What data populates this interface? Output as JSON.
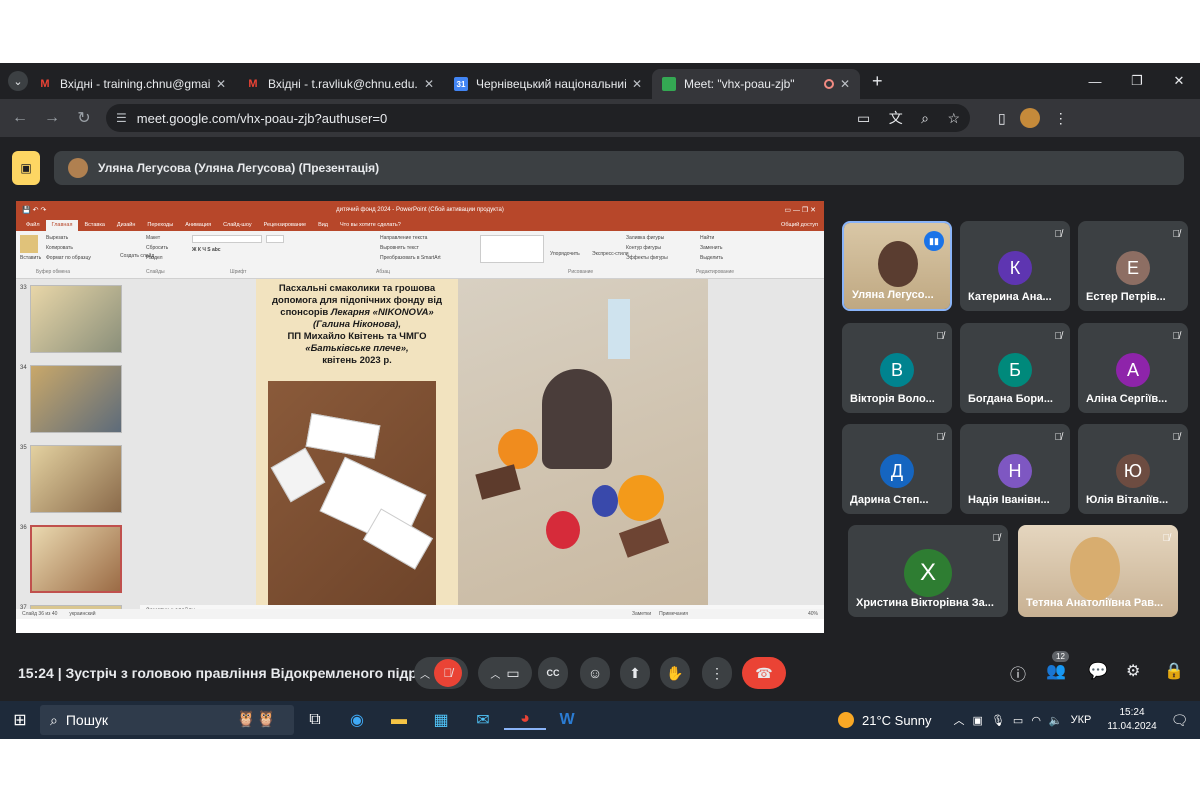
{
  "browser": {
    "tabs": [
      {
        "icon": "gmail-icon",
        "title": "Вхідні - training.chnu@gmail.co",
        "active": false
      },
      {
        "icon": "gmail-icon",
        "title": "Вхідні - t.ravliuk@chnu.edu.ua",
        "active": false
      },
      {
        "icon": "calendar-icon",
        "title": "Чернівецький національний у",
        "active": false
      },
      {
        "icon": "meet-icon",
        "title": "Meet: \"vhx-poau-zjb\"",
        "active": true
      }
    ],
    "url": "meet.google.com/vhx-poau-zjb?authuser=0"
  },
  "meet": {
    "presenter_banner": "Уляна Легусова (Уляна Легусова) (Презентація)",
    "time": "15:24",
    "meeting_title": "Зустріч з головою правління Відокремленого підр...",
    "participant_count": "12",
    "participants": [
      {
        "name": "Уляна Легусо...",
        "initial": "",
        "color": "#c9b49a",
        "video": true,
        "speaking": true
      },
      {
        "name": "Катерина Ана...",
        "initial": "К",
        "color": "#5e35b1"
      },
      {
        "name": "Естер Петрів...",
        "initial": "Е",
        "color": "#8d6e63"
      },
      {
        "name": "Вікторія Воло...",
        "initial": "В",
        "color": "#00838f"
      },
      {
        "name": "Богдана Бори...",
        "initial": "Б",
        "color": "#00897b"
      },
      {
        "name": "Аліна Сергіїв...",
        "initial": "А",
        "color": "#8e24aa"
      },
      {
        "name": "Дарина Степ...",
        "initial": "Д",
        "color": "#1565c0"
      },
      {
        "name": "Надія Іванівн...",
        "initial": "Н",
        "color": "#7e57c2"
      },
      {
        "name": "Юлія Віталіїв...",
        "initial": "Ю",
        "color": "#6d4c41"
      },
      {
        "name": "Христина Вікторівна За...",
        "initial": "Х",
        "color": "#2e7d32"
      },
      {
        "name": "Тетяна Анатоліївна Рав...",
        "initial": "",
        "color": "#b58d5e",
        "video": true
      }
    ]
  },
  "powerpoint": {
    "title": "дитячий фонд 2024 - PowerPoint (Сбой активации продукта)",
    "share_label": "Общий доступ",
    "tabs": [
      "Файл",
      "Главная",
      "Вставка",
      "Дизайн",
      "Переходы",
      "Анимация",
      "Слайд-шоу",
      "Рецензирование",
      "Вид",
      "Что вы хотите сделать?"
    ],
    "ribbon": {
      "paste": "Вставить",
      "cut": "Вырезать",
      "copy": "Копировать",
      "format": "Формат по образцу",
      "clipboard": "Буфер обмена",
      "new_slide": "Создать слайд",
      "layout": "Макет",
      "reset": "Сбросить",
      "section": "Раздел",
      "slides": "Слайды",
      "font": "Шрифт",
      "paragraph": "Абзац",
      "text_dir": "Направление текста",
      "align_text": "Выровнять текст",
      "smartart": "Преобразовать в SmartArt",
      "arrange": "Упорядочить",
      "quick_styles": "Экспресс-стили",
      "fill": "Заливка фигуры",
      "outline": "Контур фигуры",
      "effects": "Эффекты фигуры",
      "drawing": "Рисование",
      "find": "Найти",
      "replace": "Заменить",
      "select": "Выделить",
      "editing": "Редактирование"
    },
    "thumb_numbers": [
      "33",
      "34",
      "35",
      "36",
      "37"
    ],
    "slide": {
      "line1": "Пасхальні смаколики та грошова допомога для підопічних фонду від спонсорів ",
      "sponsor1": "Лекарня «NIKONOVA»",
      "sponsor1b": "(Галина Ніконова),",
      "line2": "ПП Михайло Квітень та ЧМГО",
      "sponsor2": "«Батьківське плече»,",
      "date": "квітень 2023 р."
    },
    "notes": "Заметки к слайду",
    "status_left": "Слайд 36 из 40",
    "status_lang": "украинский",
    "status_notes": "Заметки",
    "status_comments": "Примечания",
    "zoom": "40%"
  },
  "taskbar": {
    "search": "Пошук",
    "weather": "21°C  Sunny",
    "lang": "УКР",
    "time": "15:24",
    "date": "11.04.2024"
  }
}
